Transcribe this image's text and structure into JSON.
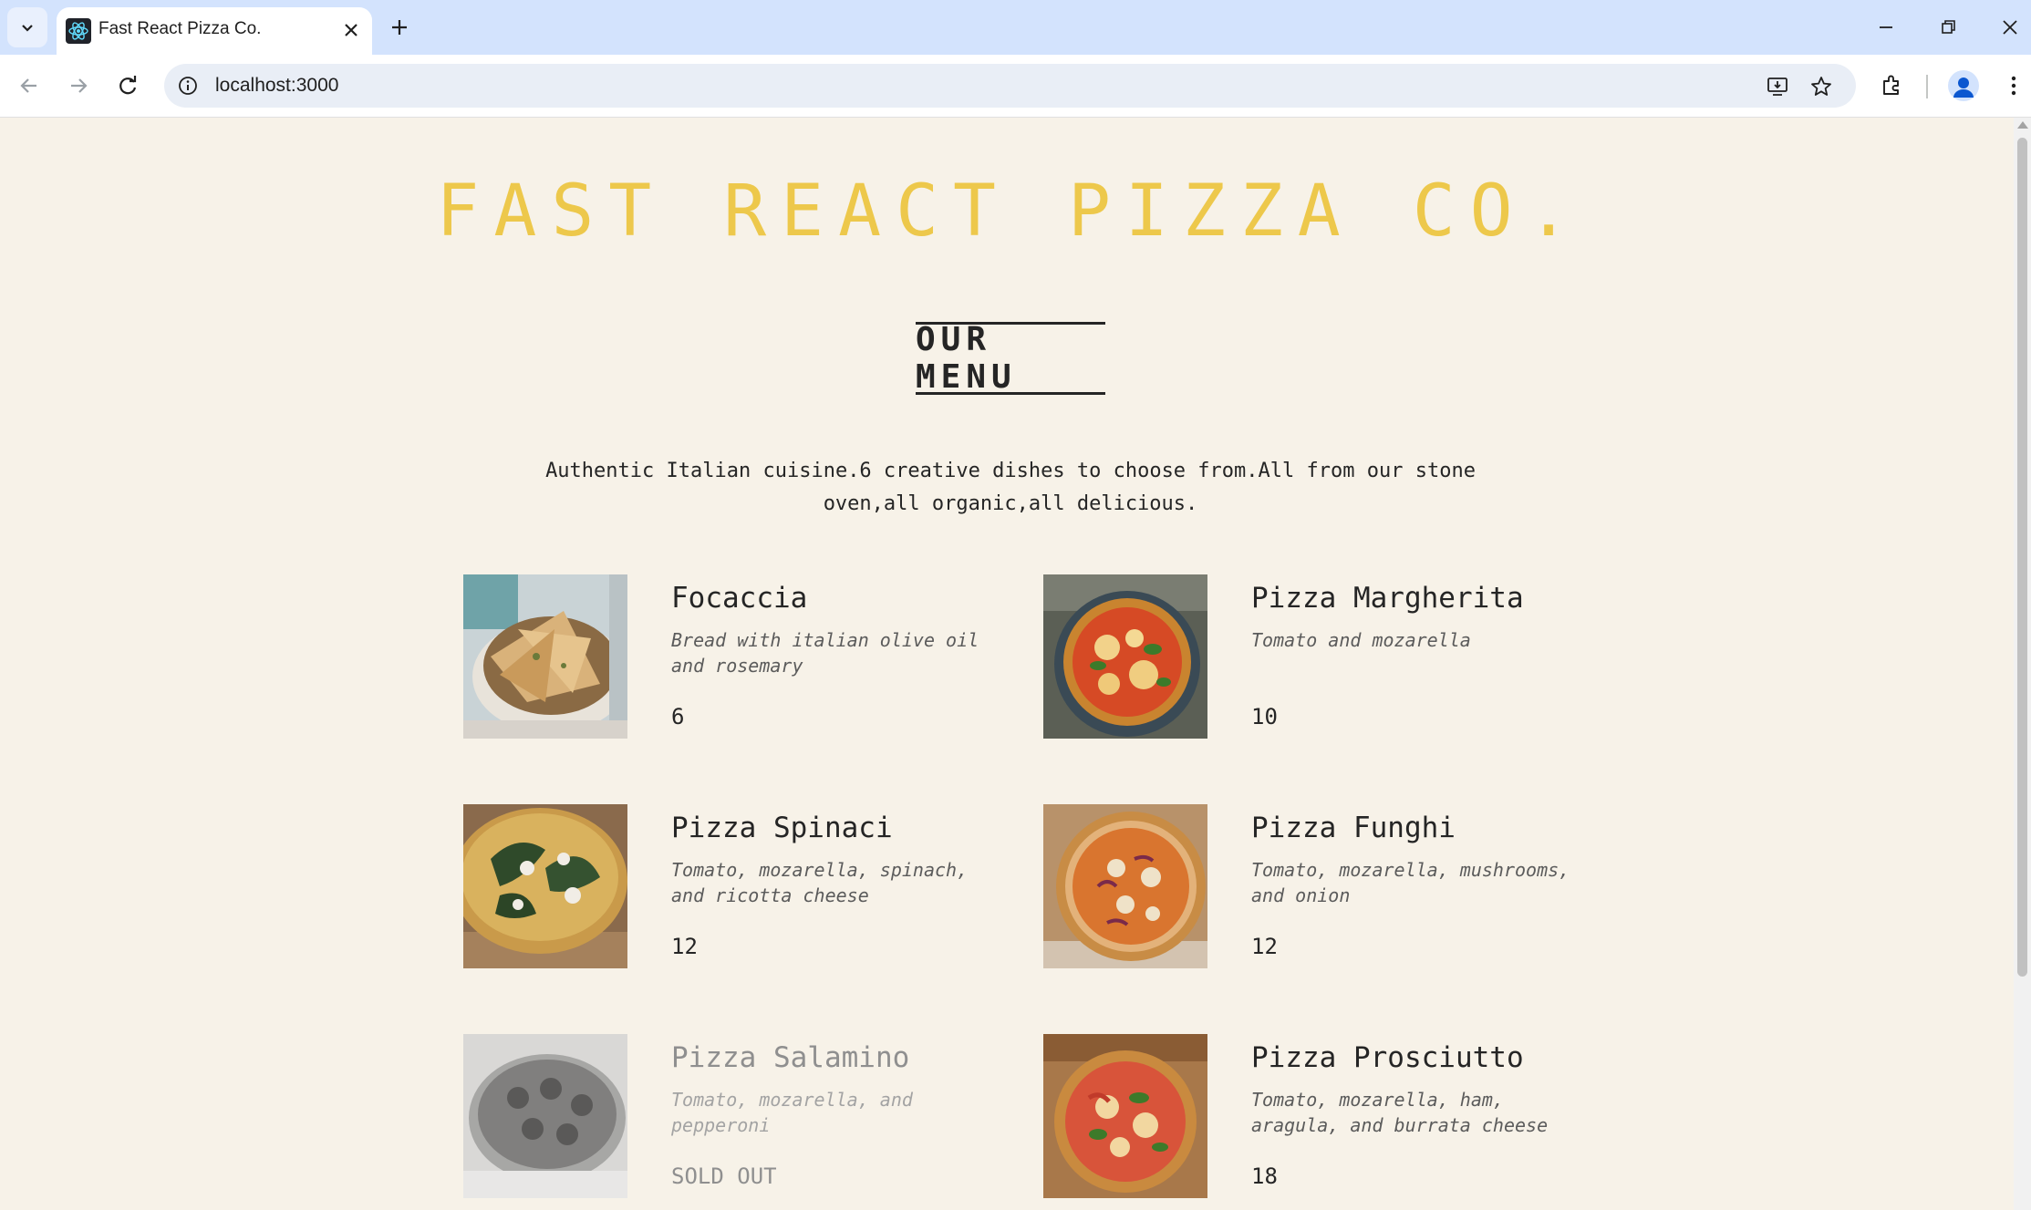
{
  "browser": {
    "tab_title": "Fast React Pizza Co.",
    "url": "localhost:3000"
  },
  "page": {
    "logo": "FAST REACT PIZZA CO.",
    "menu_title": "OUR MENU",
    "intro": "Authentic Italian cuisine.6 creative dishes to choose from.All from our stone oven,all organic,all delicious.",
    "pizzas": [
      {
        "name": "Focaccia",
        "ingredients": "Bread with italian olive oil and rosemary",
        "price": "6",
        "sold_out": false
      },
      {
        "name": "Pizza Margherita",
        "ingredients": "Tomato and mozarella",
        "price": "10",
        "sold_out": false
      },
      {
        "name": "Pizza Spinaci",
        "ingredients": "Tomato, mozarella, spinach, and ricotta cheese",
        "price": "12",
        "sold_out": false
      },
      {
        "name": "Pizza Funghi",
        "ingredients": "Tomato, mozarella, mushrooms, and onion",
        "price": "12",
        "sold_out": false
      },
      {
        "name": "Pizza Salamino",
        "ingredients": "Tomato, mozarella, and pepperoni",
        "price": "SOLD OUT",
        "sold_out": true
      },
      {
        "name": "Pizza Prosciutto",
        "ingredients": "Tomato, mozarella, ham, aragula, and burrata cheese",
        "price": "18",
        "sold_out": false
      }
    ]
  },
  "colors": {
    "background": "#f7f2e8",
    "logo": "#edc84b",
    "text": "#252525",
    "tabstrip": "#d3e3fd"
  }
}
